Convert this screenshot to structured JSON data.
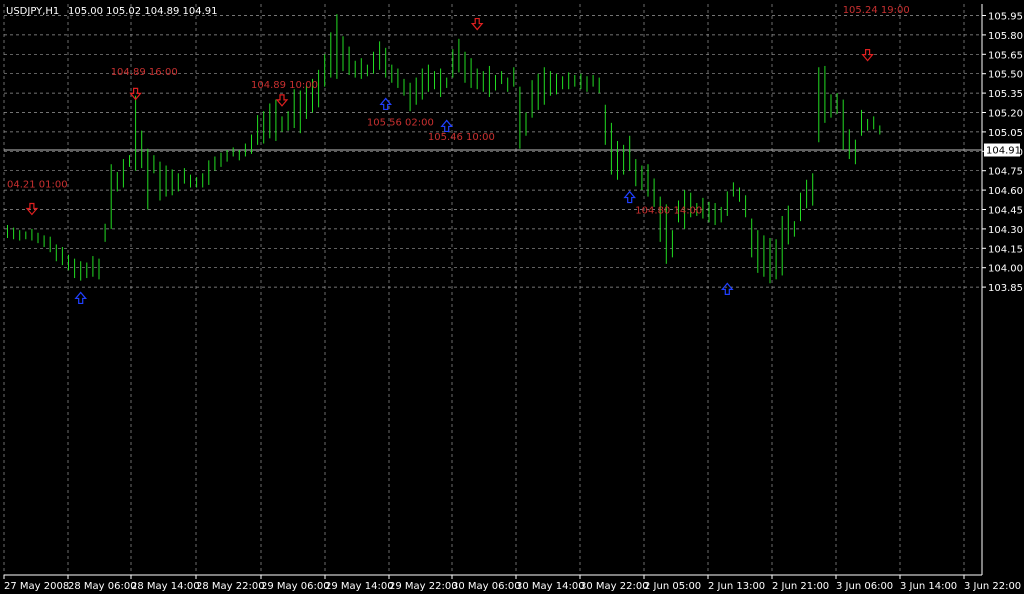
{
  "header": {
    "symbol": "USDJPY,H1",
    "ohlc": "105.00 105.02 104.89 104.91"
  },
  "current_price": "104.91",
  "colors": {
    "background": "#000000",
    "grid": "#9a9a9a",
    "bars": "#22dd22",
    "axis_text": "#ffffff",
    "arrow_down": "#e02020",
    "arrow_up": "#2040ff",
    "annotation": "#c83030"
  },
  "chart_data": {
    "type": "ohlc",
    "timeframe": "H1",
    "symbol": "USDJPY",
    "ylim": [
      103.75,
      106.0
    ],
    "y_ticks": [
      "105.95",
      "105.80",
      "105.65",
      "105.50",
      "105.35",
      "105.20",
      "105.05",
      "104.90",
      "104.75",
      "104.60",
      "104.45",
      "104.30",
      "104.15",
      "104.00",
      "103.85"
    ],
    "x_ticks": [
      "27 May 2008",
      "28 May 06:00",
      "28 May 14:00",
      "28 May 22:00",
      "29 May 06:00",
      "29 May 14:00",
      "29 May 22:00",
      "30 May 06:00",
      "30 May 14:00",
      "30 May 22:00",
      "2 Jun 05:00",
      "2 Jun 13:00",
      "2 Jun 21:00",
      "3 Jun 06:00",
      "3 Jun 14:00",
      "3 Jun 22:00"
    ],
    "grid": true,
    "bars": [
      {
        "h": 104.33,
        "l": 104.23
      },
      {
        "h": 104.31,
        "l": 104.22
      },
      {
        "h": 104.29,
        "l": 104.21
      },
      {
        "h": 104.28,
        "l": 104.22
      },
      {
        "h": 104.3,
        "l": 104.21
      },
      {
        "h": 104.27,
        "l": 104.19
      },
      {
        "h": 104.25,
        "l": 104.16
      },
      {
        "h": 104.24,
        "l": 104.12
      },
      {
        "h": 104.18,
        "l": 104.05
      },
      {
        "h": 104.16,
        "l": 104.02
      },
      {
        "h": 104.1,
        "l": 103.98
      },
      {
        "h": 104.07,
        "l": 103.92
      },
      {
        "h": 104.05,
        "l": 103.9
      },
      {
        "h": 104.04,
        "l": 103.92
      },
      {
        "h": 104.09,
        "l": 103.93
      },
      {
        "h": 104.07,
        "l": 103.91
      },
      {
        "h": 104.34,
        "l": 104.2
      },
      {
        "h": 104.8,
        "l": 104.3
      },
      {
        "h": 104.74,
        "l": 104.59
      },
      {
        "h": 104.84,
        "l": 104.62
      },
      {
        "h": 104.87,
        "l": 104.78
      },
      {
        "h": 105.33,
        "l": 104.75
      },
      {
        "h": 105.06,
        "l": 104.77
      },
      {
        "h": 104.92,
        "l": 104.45
      },
      {
        "h": 104.87,
        "l": 104.73
      },
      {
        "h": 104.82,
        "l": 104.52
      },
      {
        "h": 104.79,
        "l": 104.55
      },
      {
        "h": 104.76,
        "l": 104.56
      },
      {
        "h": 104.73,
        "l": 104.59
      },
      {
        "h": 104.77,
        "l": 104.65
      },
      {
        "h": 104.72,
        "l": 104.62
      },
      {
        "h": 104.7,
        "l": 104.62
      },
      {
        "h": 104.73,
        "l": 104.62
      },
      {
        "h": 104.83,
        "l": 104.64
      },
      {
        "h": 104.86,
        "l": 104.75
      },
      {
        "h": 104.89,
        "l": 104.78
      },
      {
        "h": 104.91,
        "l": 104.82
      },
      {
        "h": 104.93,
        "l": 104.86
      },
      {
        "h": 104.91,
        "l": 104.83
      },
      {
        "h": 104.96,
        "l": 104.86
      },
      {
        "h": 105.03,
        "l": 104.88
      },
      {
        "h": 105.18,
        "l": 104.95
      },
      {
        "h": 105.21,
        "l": 104.96
      },
      {
        "h": 105.27,
        "l": 105.0
      },
      {
        "h": 105.3,
        "l": 104.98
      },
      {
        "h": 105.17,
        "l": 105.05
      },
      {
        "h": 105.21,
        "l": 105.06
      },
      {
        "h": 105.38,
        "l": 105.08
      },
      {
        "h": 105.37,
        "l": 105.04
      },
      {
        "h": 105.41,
        "l": 105.15
      },
      {
        "h": 105.46,
        "l": 105.2
      },
      {
        "h": 105.53,
        "l": 105.24
      },
      {
        "h": 105.65,
        "l": 105.4
      },
      {
        "h": 105.82,
        "l": 105.47
      },
      {
        "h": 105.96,
        "l": 105.46
      },
      {
        "h": 105.79,
        "l": 105.52
      },
      {
        "h": 105.71,
        "l": 105.49
      },
      {
        "h": 105.6,
        "l": 105.47
      },
      {
        "h": 105.62,
        "l": 105.46
      },
      {
        "h": 105.57,
        "l": 105.48
      },
      {
        "h": 105.67,
        "l": 105.5
      },
      {
        "h": 105.75,
        "l": 105.53
      },
      {
        "h": 105.7,
        "l": 105.47
      },
      {
        "h": 105.57,
        "l": 105.43
      },
      {
        "h": 105.54,
        "l": 105.39
      },
      {
        "h": 105.46,
        "l": 105.33
      },
      {
        "h": 105.43,
        "l": 105.21
      },
      {
        "h": 105.47,
        "l": 105.26
      },
      {
        "h": 105.54,
        "l": 105.3
      },
      {
        "h": 105.57,
        "l": 105.36
      },
      {
        "h": 105.52,
        "l": 105.38
      },
      {
        "h": 105.54,
        "l": 105.32
      },
      {
        "h": 105.47,
        "l": 105.39
      },
      {
        "h": 105.69,
        "l": 105.47
      },
      {
        "h": 105.77,
        "l": 105.51
      },
      {
        "h": 105.67,
        "l": 105.43
      },
      {
        "h": 105.62,
        "l": 105.39
      },
      {
        "h": 105.54,
        "l": 105.38
      },
      {
        "h": 105.52,
        "l": 105.36
      },
      {
        "h": 105.56,
        "l": 105.32
      },
      {
        "h": 105.49,
        "l": 105.37
      },
      {
        "h": 105.52,
        "l": 105.42
      },
      {
        "h": 105.47,
        "l": 105.36
      },
      {
        "h": 105.55,
        "l": 105.4
      },
      {
        "h": 105.4,
        "l": 104.92
      },
      {
        "h": 105.2,
        "l": 105.02
      },
      {
        "h": 105.45,
        "l": 105.16
      },
      {
        "h": 105.5,
        "l": 105.22
      },
      {
        "h": 105.55,
        "l": 105.26
      },
      {
        "h": 105.52,
        "l": 105.33
      },
      {
        "h": 105.5,
        "l": 105.34
      },
      {
        "h": 105.48,
        "l": 105.38
      },
      {
        "h": 105.51,
        "l": 105.38
      },
      {
        "h": 105.49,
        "l": 105.4
      },
      {
        "h": 105.5,
        "l": 105.38
      },
      {
        "h": 105.48,
        "l": 105.36
      },
      {
        "h": 105.49,
        "l": 105.4
      },
      {
        "h": 105.47,
        "l": 105.35
      },
      {
        "h": 105.26,
        "l": 104.95
      },
      {
        "h": 105.12,
        "l": 104.72
      },
      {
        "h": 104.98,
        "l": 104.68
      },
      {
        "h": 104.95,
        "l": 104.72
      },
      {
        "h": 105.02,
        "l": 104.75
      },
      {
        "h": 104.84,
        "l": 104.63
      },
      {
        "h": 104.79,
        "l": 104.6
      },
      {
        "h": 104.8,
        "l": 104.55
      },
      {
        "h": 104.69,
        "l": 104.47
      },
      {
        "h": 104.55,
        "l": 104.2
      },
      {
        "h": 104.49,
        "l": 104.03
      },
      {
        "h": 104.29,
        "l": 104.08
      },
      {
        "h": 104.52,
        "l": 104.35
      },
      {
        "h": 104.6,
        "l": 104.3
      },
      {
        "h": 104.58,
        "l": 104.39
      },
      {
        "h": 104.5,
        "l": 104.4
      },
      {
        "h": 104.54,
        "l": 104.38
      },
      {
        "h": 104.51,
        "l": 104.35
      },
      {
        "h": 104.5,
        "l": 104.33
      },
      {
        "h": 104.47,
        "l": 104.35
      },
      {
        "h": 104.59,
        "l": 104.4
      },
      {
        "h": 104.66,
        "l": 104.55
      },
      {
        "h": 104.62,
        "l": 104.51
      },
      {
        "h": 104.56,
        "l": 104.39
      },
      {
        "h": 104.38,
        "l": 104.08
      },
      {
        "h": 104.29,
        "l": 103.96
      },
      {
        "h": 104.25,
        "l": 103.93
      },
      {
        "h": 104.23,
        "l": 103.88
      },
      {
        "h": 104.22,
        "l": 103.91
      },
      {
        "h": 104.4,
        "l": 103.94
      },
      {
        "h": 104.48,
        "l": 104.18
      },
      {
        "h": 104.36,
        "l": 104.24
      },
      {
        "h": 104.58,
        "l": 104.36
      },
      {
        "h": 104.68,
        "l": 104.46
      },
      {
        "h": 104.73,
        "l": 104.48
      },
      {
        "h": 105.55,
        "l": 104.97
      },
      {
        "h": 105.56,
        "l": 105.12
      },
      {
        "h": 105.34,
        "l": 105.16
      },
      {
        "h": 105.35,
        "l": 105.19
      },
      {
        "h": 105.3,
        "l": 104.91
      },
      {
        "h": 105.07,
        "l": 104.84
      },
      {
        "h": 104.99,
        "l": 104.8
      },
      {
        "h": 105.22,
        "l": 105.02
      },
      {
        "h": 105.15,
        "l": 105.06
      },
      {
        "h": 105.17,
        "l": 105.07
      },
      {
        "h": 105.1,
        "l": 105.03
      }
    ],
    "arrows": [
      {
        "dir": "down",
        "bar": 4,
        "price": 104.45
      },
      {
        "dir": "up",
        "bar": 12,
        "price": 103.77
      },
      {
        "dir": "down",
        "bar": 21,
        "price": 105.34
      },
      {
        "dir": "down",
        "bar": 45,
        "price": 105.29
      },
      {
        "dir": "up",
        "bar": 62,
        "price": 105.27
      },
      {
        "dir": "up",
        "bar": 72,
        "price": 105.1
      },
      {
        "dir": "down",
        "bar": 77,
        "price": 105.88
      },
      {
        "dir": "up",
        "bar": 102,
        "price": 104.55
      },
      {
        "dir": "up",
        "bar": 118,
        "price": 103.84
      },
      {
        "dir": "down",
        "bar": 141,
        "price": 105.64
      }
    ],
    "annotations": [
      {
        "text": "104.89 16:00",
        "price": 105.52,
        "bar": 17
      },
      {
        "text": "104.89 10:00",
        "price": 105.42,
        "bar": 40
      },
      {
        "text": "105.56 02:00",
        "price": 105.13,
        "bar": 59
      },
      {
        "text": "105.46 10:00",
        "price": 105.02,
        "bar": 69
      },
      {
        "text": "04.21 01:00",
        "price": 104.65,
        "bar": 0
      },
      {
        "text": "104.80 14:00",
        "price": 104.45,
        "bar": 103
      },
      {
        "text": "105.24 19:00",
        "price": 106.0,
        "bar": 137
      }
    ]
  }
}
